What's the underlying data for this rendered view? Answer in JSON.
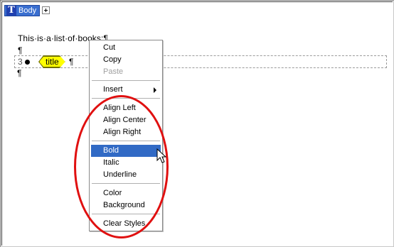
{
  "toolbar": {
    "body_tag": "Body",
    "t_glyph": "T"
  },
  "document": {
    "line1": "This·is·a·list·of·books:¶",
    "pilcrow": "¶",
    "list_number": "3",
    "list_item_tag": "title",
    "list_item_end": "¶"
  },
  "context_menu": {
    "cut": "Cut",
    "copy": "Copy",
    "paste": "Paste",
    "insert": "Insert",
    "align_left": "Align Left",
    "align_center": "Align Center",
    "align_right": "Align Right",
    "bold": "Bold",
    "italic": "Italic",
    "underline": "Underline",
    "color": "Color",
    "background": "Background",
    "clear_styles": "Clear Styles",
    "selected_item": "Bold"
  },
  "colors": {
    "selection": "#316ac5",
    "annotation": "#e01010",
    "tag_fill": "#ffff00"
  },
  "icons": [
    "t-icon",
    "expand-plus-icon",
    "submenu-arrow-icon",
    "mouse-pointer-icon"
  ]
}
